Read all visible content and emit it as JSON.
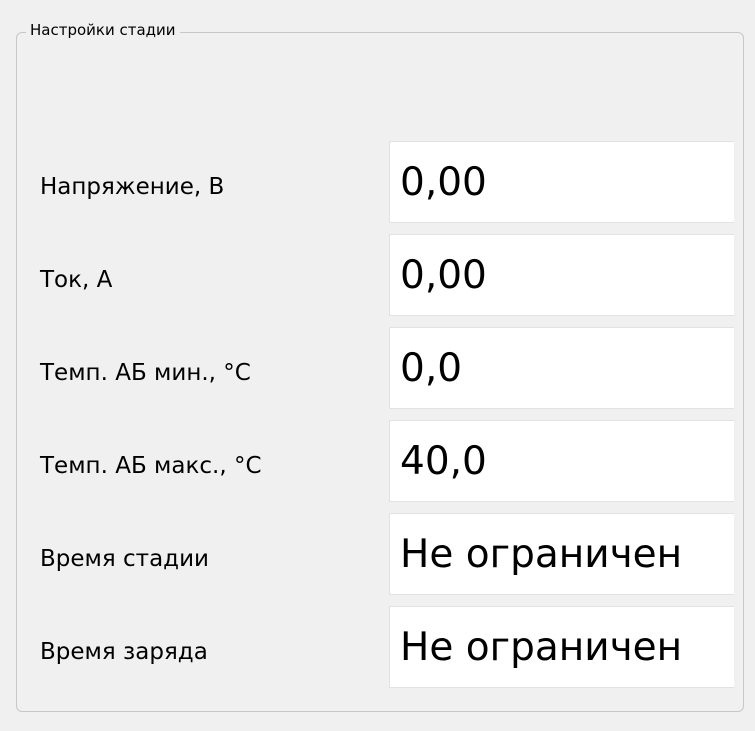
{
  "group": {
    "title": "Настройки стадии"
  },
  "fields": [
    {
      "label": "Напряжение, В",
      "value": "0,00"
    },
    {
      "label": "Ток, А",
      "value": "0,00"
    },
    {
      "label": "Темп. АБ мин., °С",
      "value": "0,0"
    },
    {
      "label": "Темп. АБ макс., °С",
      "value": "40,0"
    },
    {
      "label": "Время стадии",
      "value": "Не ограничен"
    },
    {
      "label": "Время заряда",
      "value": "Не ограничен"
    }
  ],
  "colors": {
    "window_background": "#f0f0f0",
    "group_border": "#c7c7c7",
    "input_background": "#ffffff",
    "text": "#000000"
  }
}
